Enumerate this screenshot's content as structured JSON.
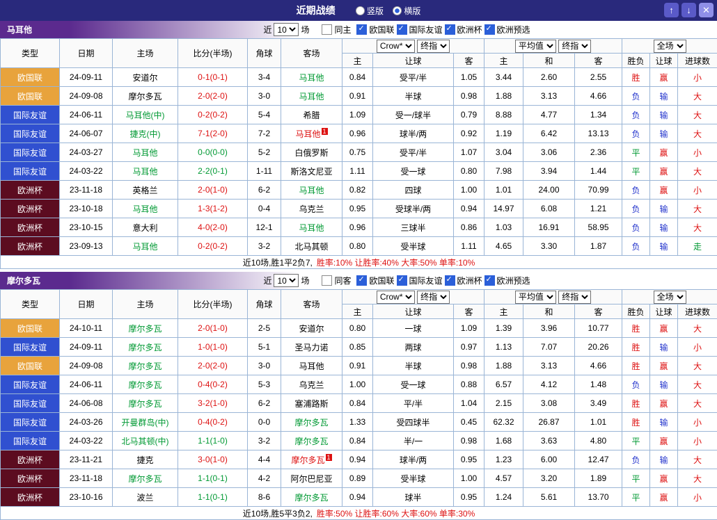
{
  "titlebar": {
    "title": "近期战绩",
    "radios": [
      {
        "label": "竖版",
        "selected": false
      },
      {
        "label": "横版",
        "selected": true
      }
    ],
    "buttons": {
      "up": "↑",
      "down": "↓",
      "close": "✕"
    }
  },
  "filter": {
    "near": "近",
    "count": "10",
    "games": "场",
    "leagues": [
      "欧国联",
      "国际友谊",
      "欧洲杯",
      "欧洲预选"
    ]
  },
  "header": {
    "cols": [
      "类型",
      "日期",
      "主场",
      "比分(半场)",
      "角球",
      "客场"
    ],
    "selects": {
      "crow": "Crow*",
      "final": "终指",
      "avg": "平均值",
      "full": "全场"
    },
    "sub": [
      "主",
      "让球",
      "客",
      "主",
      "和",
      "客",
      "胜负",
      "让球",
      "进球数"
    ]
  },
  "colors": {
    "ui": {
      "titlebar": "#29297c",
      "section": "#5b2a8e",
      "checkbox": "#2b5fd9"
    },
    "league": {
      "nl": "#e8a33c",
      "fr": "#3050d0",
      "ec": "#5c0c20"
    },
    "text": {
      "green": "#009933",
      "red": "#dd1111",
      "blue": "#2233cc"
    }
  },
  "sections": [
    {
      "team": "马耳他",
      "same": "同主",
      "rows": [
        {
          "lg": "nl",
          "lgt": "欧国联",
          "d": "24-09-11",
          "h": "安道尔",
          "hc": "k",
          "hb": "",
          "s": "0-1(0-1)",
          "sc": "r",
          "cn": "3-4",
          "a": "马耳他",
          "ac": "g",
          "ab": "",
          "od": [
            "0.84",
            "受平/半",
            "1.05"
          ],
          "av": [
            "3.44",
            "2.60",
            "2.55"
          ],
          "rs": [
            [
              "胜",
              "r"
            ],
            [
              "赢",
              "r"
            ],
            [
              "小",
              "r"
            ]
          ]
        },
        {
          "lg": "nl",
          "lgt": "欧国联",
          "d": "24-09-08",
          "h": "摩尔多瓦",
          "hc": "k",
          "hb": "",
          "s": "2-0(2-0)",
          "sc": "r",
          "cn": "3-0",
          "a": "马耳他",
          "ac": "g",
          "ab": "",
          "od": [
            "0.91",
            "半球",
            "0.98"
          ],
          "av": [
            "1.88",
            "3.13",
            "4.66"
          ],
          "rs": [
            [
              "负",
              "b"
            ],
            [
              "输",
              "b"
            ],
            [
              "大",
              "r"
            ]
          ]
        },
        {
          "lg": "fr",
          "lgt": "国际友谊",
          "d": "24-06-11",
          "h": "马耳他(中)",
          "hc": "g",
          "hb": "",
          "s": "0-2(0-2)",
          "sc": "r",
          "cn": "5-4",
          "a": "希腊",
          "ac": "k",
          "ab": "",
          "od": [
            "1.09",
            "受一/球半",
            "0.79"
          ],
          "av": [
            "8.88",
            "4.77",
            "1.34"
          ],
          "rs": [
            [
              "负",
              "b"
            ],
            [
              "输",
              "b"
            ],
            [
              "大",
              "r"
            ]
          ]
        },
        {
          "lg": "fr",
          "lgt": "国际友谊",
          "d": "24-06-07",
          "h": "捷克(中)",
          "hc": "g",
          "hb": "",
          "s": "7-1(2-0)",
          "sc": "r",
          "cn": "7-2",
          "a": "马耳他",
          "ac": "r",
          "ab": "1",
          "od": [
            "0.96",
            "球半/两",
            "0.92"
          ],
          "av": [
            "1.19",
            "6.42",
            "13.13"
          ],
          "rs": [
            [
              "负",
              "b"
            ],
            [
              "输",
              "b"
            ],
            [
              "大",
              "r"
            ]
          ]
        },
        {
          "lg": "fr",
          "lgt": "国际友谊",
          "d": "24-03-27",
          "h": "马耳他",
          "hc": "g",
          "hb": "",
          "s": "0-0(0-0)",
          "sc": "g",
          "cn": "5-2",
          "a": "白俄罗斯",
          "ac": "k",
          "ab": "",
          "od": [
            "0.75",
            "受平/半",
            "1.07"
          ],
          "av": [
            "3.04",
            "3.06",
            "2.36"
          ],
          "rs": [
            [
              "平",
              "g"
            ],
            [
              "赢",
              "r"
            ],
            [
              "小",
              "r"
            ]
          ]
        },
        {
          "lg": "fr",
          "lgt": "国际友谊",
          "d": "24-03-22",
          "h": "马耳他",
          "hc": "g",
          "hb": "",
          "s": "2-2(0-1)",
          "sc": "g",
          "cn": "1-11",
          "a": "斯洛文尼亚",
          "ac": "k",
          "ab": "",
          "od": [
            "1.11",
            "受一球",
            "0.80"
          ],
          "av": [
            "7.98",
            "3.94",
            "1.44"
          ],
          "rs": [
            [
              "平",
              "g"
            ],
            [
              "赢",
              "r"
            ],
            [
              "大",
              "r"
            ]
          ]
        },
        {
          "lg": "ec",
          "lgt": "欧洲杯",
          "d": "23-11-18",
          "h": "英格兰",
          "hc": "k",
          "hb": "",
          "s": "2-0(1-0)",
          "sc": "r",
          "cn": "6-2",
          "a": "马耳他",
          "ac": "g",
          "ab": "",
          "od": [
            "0.82",
            "四球",
            "1.00"
          ],
          "av": [
            "1.01",
            "24.00",
            "70.99"
          ],
          "rs": [
            [
              "负",
              "b"
            ],
            [
              "赢",
              "r"
            ],
            [
              "小",
              "r"
            ]
          ]
        },
        {
          "lg": "ec",
          "lgt": "欧洲杯",
          "d": "23-10-18",
          "h": "马耳他",
          "hc": "g",
          "hb": "",
          "s": "1-3(1-2)",
          "sc": "r",
          "cn": "0-4",
          "a": "乌克兰",
          "ac": "k",
          "ab": "",
          "od": [
            "0.95",
            "受球半/两",
            "0.94"
          ],
          "av": [
            "14.97",
            "6.08",
            "1.21"
          ],
          "rs": [
            [
              "负",
              "b"
            ],
            [
              "输",
              "b"
            ],
            [
              "大",
              "r"
            ]
          ]
        },
        {
          "lg": "ec",
          "lgt": "欧洲杯",
          "d": "23-10-15",
          "h": "意大利",
          "hc": "k",
          "hb": "",
          "s": "4-0(2-0)",
          "sc": "r",
          "cn": "12-1",
          "a": "马耳他",
          "ac": "g",
          "ab": "",
          "od": [
            "0.96",
            "三球半",
            "0.86"
          ],
          "av": [
            "1.03",
            "16.91",
            "58.95"
          ],
          "rs": [
            [
              "负",
              "b"
            ],
            [
              "输",
              "b"
            ],
            [
              "大",
              "r"
            ]
          ]
        },
        {
          "lg": "ec",
          "lgt": "欧洲杯",
          "d": "23-09-13",
          "h": "马耳他",
          "hc": "g",
          "hb": "",
          "s": "0-2(0-2)",
          "sc": "r",
          "cn": "3-2",
          "a": "北马其顿",
          "ac": "k",
          "ab": "",
          "od": [
            "0.80",
            "受半球",
            "1.11"
          ],
          "av": [
            "4.65",
            "3.30",
            "1.87"
          ],
          "rs": [
            [
              "负",
              "b"
            ],
            [
              "输",
              "b"
            ],
            [
              "走",
              "g"
            ]
          ]
        }
      ],
      "summary": {
        "lead": "近10场,胜1平2负7,",
        "stats": "胜率:10% 让胜率:40% 大率:50% 单率:10%"
      }
    },
    {
      "team": "摩尔多瓦",
      "same": "同客",
      "rows": [
        {
          "lg": "nl",
          "lgt": "欧国联",
          "d": "24-10-11",
          "h": "摩尔多瓦",
          "hc": "g",
          "hb": "",
          "s": "2-0(1-0)",
          "sc": "r",
          "cn": "2-5",
          "a": "安道尔",
          "ac": "k",
          "ab": "",
          "od": [
            "0.80",
            "一球",
            "1.09"
          ],
          "av": [
            "1.39",
            "3.96",
            "10.77"
          ],
          "rs": [
            [
              "胜",
              "r"
            ],
            [
              "赢",
              "r"
            ],
            [
              "大",
              "r"
            ]
          ]
        },
        {
          "lg": "fr",
          "lgt": "国际友谊",
          "d": "24-09-11",
          "h": "摩尔多瓦",
          "hc": "g",
          "hb": "",
          "s": "1-0(1-0)",
          "sc": "r",
          "cn": "5-1",
          "a": "圣马力诺",
          "ac": "k",
          "ab": "",
          "od": [
            "0.85",
            "两球",
            "0.97"
          ],
          "av": [
            "1.13",
            "7.07",
            "20.26"
          ],
          "rs": [
            [
              "胜",
              "r"
            ],
            [
              "输",
              "b"
            ],
            [
              "小",
              "r"
            ]
          ]
        },
        {
          "lg": "nl",
          "lgt": "欧国联",
          "d": "24-09-08",
          "h": "摩尔多瓦",
          "hc": "g",
          "hb": "",
          "s": "2-0(2-0)",
          "sc": "r",
          "cn": "3-0",
          "a": "马耳他",
          "ac": "k",
          "ab": "",
          "od": [
            "0.91",
            "半球",
            "0.98"
          ],
          "av": [
            "1.88",
            "3.13",
            "4.66"
          ],
          "rs": [
            [
              "胜",
              "r"
            ],
            [
              "赢",
              "r"
            ],
            [
              "大",
              "r"
            ]
          ]
        },
        {
          "lg": "fr",
          "lgt": "国际友谊",
          "d": "24-06-11",
          "h": "摩尔多瓦",
          "hc": "g",
          "hb": "",
          "s": "0-4(0-2)",
          "sc": "r",
          "cn": "5-3",
          "a": "乌克兰",
          "ac": "k",
          "ab": "",
          "od": [
            "1.00",
            "受一球",
            "0.88"
          ],
          "av": [
            "6.57",
            "4.12",
            "1.48"
          ],
          "rs": [
            [
              "负",
              "b"
            ],
            [
              "输",
              "b"
            ],
            [
              "大",
              "r"
            ]
          ]
        },
        {
          "lg": "fr",
          "lgt": "国际友谊",
          "d": "24-06-08",
          "h": "摩尔多瓦",
          "hc": "g",
          "hb": "",
          "s": "3-2(1-0)",
          "sc": "r",
          "cn": "6-2",
          "a": "塞浦路斯",
          "ac": "k",
          "ab": "",
          "od": [
            "0.84",
            "平/半",
            "1.04"
          ],
          "av": [
            "2.15",
            "3.08",
            "3.49"
          ],
          "rs": [
            [
              "胜",
              "r"
            ],
            [
              "赢",
              "r"
            ],
            [
              "大",
              "r"
            ]
          ]
        },
        {
          "lg": "fr",
          "lgt": "国际友谊",
          "d": "24-03-26",
          "h": "开曼群岛(中)",
          "hc": "g",
          "hb": "",
          "s": "0-4(0-2)",
          "sc": "r",
          "cn": "0-0",
          "a": "摩尔多瓦",
          "ac": "g",
          "ab": "",
          "od": [
            "1.33",
            "受四球半",
            "0.45"
          ],
          "av": [
            "62.32",
            "26.87",
            "1.01"
          ],
          "rs": [
            [
              "胜",
              "r"
            ],
            [
              "输",
              "b"
            ],
            [
              "小",
              "r"
            ]
          ]
        },
        {
          "lg": "fr",
          "lgt": "国际友谊",
          "d": "24-03-22",
          "h": "北马其顿(中)",
          "hc": "g",
          "hb": "",
          "s": "1-1(1-0)",
          "sc": "g",
          "cn": "3-2",
          "a": "摩尔多瓦",
          "ac": "g",
          "ab": "",
          "od": [
            "0.84",
            "半/一",
            "0.98"
          ],
          "av": [
            "1.68",
            "3.63",
            "4.80"
          ],
          "rs": [
            [
              "平",
              "g"
            ],
            [
              "赢",
              "r"
            ],
            [
              "小",
              "r"
            ]
          ]
        },
        {
          "lg": "ec",
          "lgt": "欧洲杯",
          "d": "23-11-21",
          "h": "捷克",
          "hc": "k",
          "hb": "",
          "s": "3-0(1-0)",
          "sc": "r",
          "cn": "4-4",
          "a": "摩尔多瓦",
          "ac": "r",
          "ab": "1",
          "od": [
            "0.94",
            "球半/两",
            "0.95"
          ],
          "av": [
            "1.23",
            "6.00",
            "12.47"
          ],
          "rs": [
            [
              "负",
              "b"
            ],
            [
              "输",
              "b"
            ],
            [
              "大",
              "r"
            ]
          ]
        },
        {
          "lg": "ec",
          "lgt": "欧洲杯",
          "d": "23-11-18",
          "h": "摩尔多瓦",
          "hc": "g",
          "hb": "",
          "s": "1-1(0-1)",
          "sc": "g",
          "cn": "4-2",
          "a": "阿尔巴尼亚",
          "ac": "k",
          "ab": "",
          "od": [
            "0.89",
            "受半球",
            "1.00"
          ],
          "av": [
            "4.57",
            "3.20",
            "1.89"
          ],
          "rs": [
            [
              "平",
              "g"
            ],
            [
              "赢",
              "r"
            ],
            [
              "大",
              "r"
            ]
          ]
        },
        {
          "lg": "ec",
          "lgt": "欧洲杯",
          "d": "23-10-16",
          "h": "波兰",
          "hc": "k",
          "hb": "",
          "s": "1-1(0-1)",
          "sc": "g",
          "cn": "8-6",
          "a": "摩尔多瓦",
          "ac": "g",
          "ab": "",
          "od": [
            "0.94",
            "球半",
            "0.95"
          ],
          "av": [
            "1.24",
            "5.61",
            "13.70"
          ],
          "rs": [
            [
              "平",
              "g"
            ],
            [
              "赢",
              "r"
            ],
            [
              "小",
              "r"
            ]
          ]
        }
      ],
      "summary": {
        "lead": "近10场,胜5平3负2,",
        "stats": "胜率:50% 让胜率:60% 大率:60% 单率:30%"
      }
    }
  ]
}
